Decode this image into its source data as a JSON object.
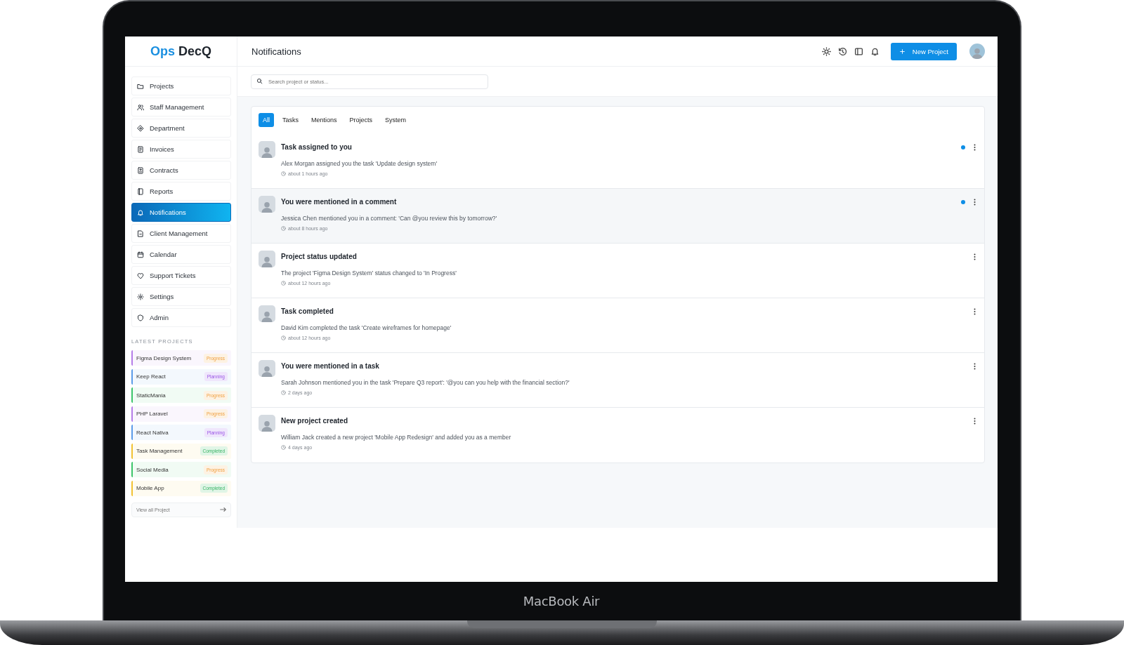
{
  "logo": {
    "primary": "Ops",
    "secondary": "DecQ"
  },
  "header": {
    "title": "Notifications",
    "new_project_button": "New Project"
  },
  "search": {
    "placeholder": "Search project or status..."
  },
  "sidebar": {
    "items": [
      {
        "label": "Projects",
        "selected": false
      },
      {
        "label": "Staff Management",
        "selected": false
      },
      {
        "label": "Department",
        "selected": false
      },
      {
        "label": "Invoices",
        "selected": false
      },
      {
        "label": "Contracts",
        "selected": false
      },
      {
        "label": "Reports",
        "selected": false
      },
      {
        "label": "Notifications",
        "selected": true
      },
      {
        "label": "Client Management",
        "selected": false
      },
      {
        "label": "Calendar",
        "selected": false
      },
      {
        "label": "Support Tickets",
        "selected": false
      },
      {
        "label": "Settings",
        "selected": false
      },
      {
        "label": "Admin",
        "selected": false
      }
    ]
  },
  "latest_projects": {
    "heading": "LATEST PROJECTS",
    "items": [
      {
        "name": "Figma Design System",
        "status": "Progress",
        "kind": "progress",
        "color": "#b57ce8"
      },
      {
        "name": "Keep React",
        "status": "Planning",
        "kind": "planning",
        "color": "#5b9be8"
      },
      {
        "name": "StaticMania",
        "status": "Progress",
        "kind": "progress",
        "color": "#3cc46a"
      },
      {
        "name": "PHP Laravel",
        "status": "Progress",
        "kind": "progress",
        "color": "#b57ce8"
      },
      {
        "name": "React Nativa",
        "status": "Planning",
        "kind": "planning",
        "color": "#5b9be8"
      },
      {
        "name": "Task Management",
        "status": "Completed",
        "kind": "completed",
        "color": "#f2c232"
      },
      {
        "name": "Social Media",
        "status": "Progress",
        "kind": "progress",
        "color": "#3cc46a"
      },
      {
        "name": "Mobile App",
        "status": "Completed",
        "kind": "completed",
        "color": "#f2c232"
      }
    ],
    "view_all": "View all Project"
  },
  "notifications": {
    "tabs": [
      {
        "label": "All",
        "selected": true
      },
      {
        "label": "Tasks",
        "selected": false
      },
      {
        "label": "Mentions",
        "selected": false
      },
      {
        "label": "Projects",
        "selected": false
      },
      {
        "label": "System",
        "selected": false
      }
    ],
    "items": [
      {
        "title": "Task assigned to you",
        "message": "Alex Morgan assigned you the task 'Update design system'",
        "time": "about 1 hours ago",
        "unread": true,
        "highlighted": false
      },
      {
        "title": "You were mentioned in a comment",
        "message": "Jessica Chen mentioned you in a comment: 'Can @you review this by tomorrow?'",
        "time": "about 8 hours ago",
        "unread": true,
        "highlighted": true
      },
      {
        "title": "Project status updated",
        "message": "The project 'Figma Design System' status changed to 'In Progress'",
        "time": "about 12 hours ago",
        "unread": false,
        "highlighted": false
      },
      {
        "title": "Task completed",
        "message": "David Kim completed the task 'Create wireframes for homepage'",
        "time": "about 12 hours ago",
        "unread": false,
        "highlighted": false
      },
      {
        "title": "You were mentioned in a task",
        "message": "Sarah Johnson mentioned you in the task 'Prepare Q3 report': '@you can you help with the financial section?'",
        "time": "2 days ago",
        "unread": false,
        "highlighted": false
      },
      {
        "title": "New project created",
        "message": "William Jack created a new project 'Mobile App Redesign' and added you as a member",
        "time": "4 days ago",
        "unread": false,
        "highlighted": false
      }
    ]
  },
  "device_label": "MacBook Air"
}
